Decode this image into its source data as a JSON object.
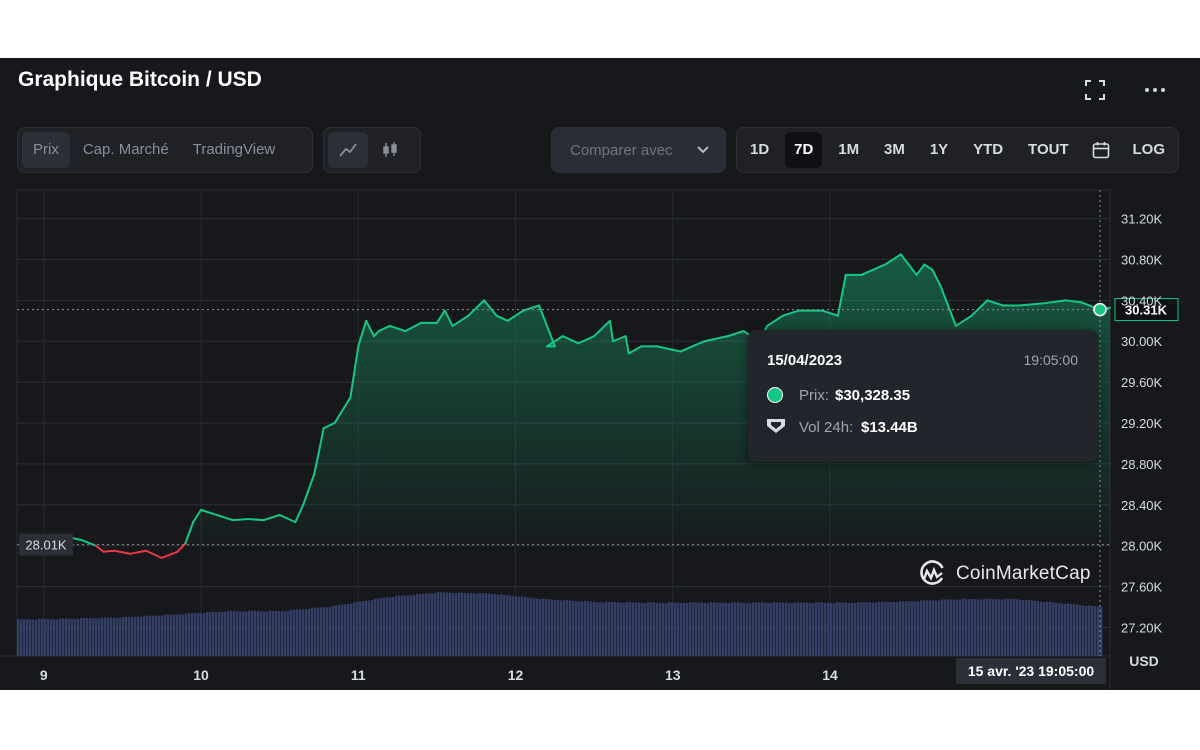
{
  "header": {
    "title": "Graphique Bitcoin / USD",
    "tabs": [
      "Prix",
      "Cap. Marché",
      "TradingView"
    ],
    "active_tab": "Prix",
    "compare_label": "Comparer avec",
    "ranges": [
      "1D",
      "7D",
      "1M",
      "3M",
      "1Y",
      "YTD",
      "TOUT"
    ],
    "active_range": "7D",
    "log_label": "LOG",
    "icons": [
      "fullscreen-icon",
      "more-icon",
      "line-chart-icon",
      "candlestick-icon",
      "chevron-down-icon",
      "calendar-icon"
    ]
  },
  "colors": {
    "up": "#16c784",
    "down": "#ea3943",
    "volume": "#3a4775",
    "background": "#17181b",
    "tooltip": "#22252c"
  },
  "tooltip": {
    "date": "15/04/2023",
    "time": "19:05:00",
    "price_label": "Prix:",
    "price_value": "$30,328.35",
    "volume_label": "Vol 24h:",
    "volume_value": "$13.44B"
  },
  "chart_data": {
    "type": "area",
    "y_axis_unit": "USD",
    "ylim": [
      26920,
      31480
    ],
    "ytick_values": [
      27200,
      27600,
      28000,
      28400,
      28800,
      29200,
      29600,
      30000,
      30400,
      30800,
      31200
    ],
    "yticks": [
      "27.20K",
      "27.60K",
      "28.00K",
      "28.40K",
      "28.80K",
      "29.20K",
      "29.60K",
      "30.00K",
      "30.40K",
      "30.80K",
      "31.20K"
    ],
    "xlim": [
      8.83,
      15.78
    ],
    "xtick_values": [
      9,
      10,
      11,
      12,
      13,
      14
    ],
    "xticks": [
      "9",
      "10",
      "11",
      "12",
      "13",
      "14"
    ],
    "baseline_value": 28010,
    "baseline_label": "28.01K",
    "last_value": 30310,
    "last_label": "30.31K",
    "crosshair_label": "15 avr. '23  19:05:00",
    "grid": true,
    "series": [
      {
        "x": [
          9.17,
          9.25,
          9.33,
          9.38,
          9.45,
          9.55,
          9.65,
          9.75,
          9.85,
          9.9,
          9.95,
          10.0,
          10.1,
          10.2,
          10.3,
          10.4,
          10.5,
          10.6,
          10.65,
          10.72,
          10.75,
          10.78,
          10.85,
          10.95,
          11.0,
          11.05,
          11.1,
          11.13,
          11.2,
          11.3,
          11.4,
          11.5,
          11.55,
          11.6,
          11.7,
          11.8,
          11.88,
          11.95,
          12.05,
          12.15,
          12.25,
          12.2,
          12.3,
          12.4,
          12.5,
          12.6,
          12.62,
          12.7,
          12.72,
          12.8,
          12.9,
          13.05,
          13.2,
          13.35,
          13.45,
          13.55,
          13.6,
          13.7,
          13.8,
          13.95,
          14.05,
          14.1,
          14.2,
          14.35,
          14.45,
          14.55,
          14.6,
          14.65,
          14.7,
          14.8,
          14.9,
          15.0,
          15.1,
          15.2,
          15.35,
          15.5,
          15.6,
          15.7,
          15.78
        ],
        "y": [
          28080,
          28050,
          28000,
          27940,
          27950,
          27920,
          27950,
          27880,
          27940,
          28020,
          28230,
          28350,
          28300,
          28250,
          28260,
          28250,
          28300,
          28230,
          28400,
          28700,
          28920,
          29150,
          29200,
          29450,
          29950,
          30200,
          30050,
          30100,
          30150,
          30100,
          30180,
          30180,
          30300,
          30150,
          30250,
          30400,
          30250,
          30200,
          30300,
          30350,
          29950,
          29950,
          30050,
          29980,
          30050,
          30200,
          30000,
          30050,
          29880,
          29950,
          29950,
          29900,
          30000,
          30050,
          30100,
          30000,
          30150,
          30250,
          30300,
          30300,
          30250,
          30650,
          30650,
          30750,
          30850,
          30650,
          30750,
          30700,
          30550,
          30150,
          30250,
          30400,
          30350,
          30350,
          30370,
          30400,
          30380,
          30320,
          30328
        ]
      }
    ],
    "volume_series": {
      "x": [
        8.83,
        9.17,
        9.5,
        9.83,
        10.17,
        10.5,
        10.83,
        11.17,
        11.5,
        11.83,
        12.17,
        12.5,
        12.83,
        13.17,
        13.5,
        13.83,
        14.17,
        14.5,
        14.83,
        15.17,
        15.5,
        15.78
      ],
      "values": [
        10.0,
        10.2,
        10.6,
        11.4,
        12.3,
        12.3,
        13.6,
        16.1,
        17.4,
        17.1,
        15.6,
        14.8,
        14.6,
        14.6,
        14.6,
        14.6,
        14.6,
        15.0,
        15.6,
        15.6,
        14.3,
        13.2
      ]
    }
  }
}
